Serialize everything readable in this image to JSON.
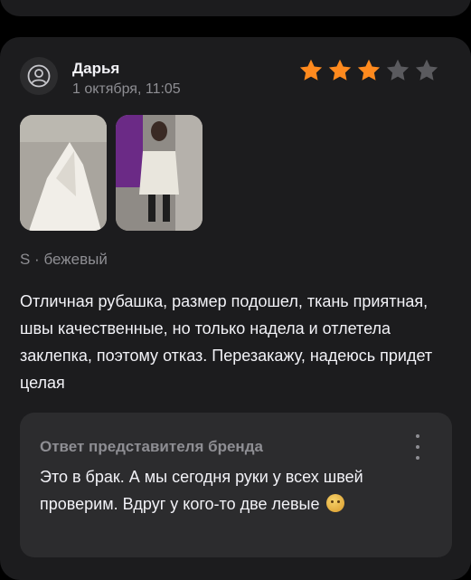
{
  "review": {
    "author": "Дарья",
    "date": "1 октября, 11:05",
    "rating": 3,
    "rating_max": 5,
    "variant": "S · бежевый",
    "text": "Отличная рубашка, размер подошел, ткань приятная, швы качественные, но только надела и отлетела заклепка, поэтому отказ. Перезакажу, надеюсь придет целая"
  },
  "reply": {
    "title": "Ответ представителя бренда",
    "text": "Это в брак. А мы сегодня руки у всех швей проверим. Вдруг у кого-то две левые",
    "emoji": "face-with-tongue-icon"
  },
  "icons": {
    "avatar": "user-icon",
    "more": "more-vertical-icon",
    "star": "star-icon"
  },
  "colors": {
    "background": "#000000",
    "card": "#1c1c1e",
    "reply_bg": "#2c2c2e",
    "star_filled": "#ff8a1e",
    "star_empty": "#5a5a5e",
    "secondary_text": "#8e8e93"
  }
}
